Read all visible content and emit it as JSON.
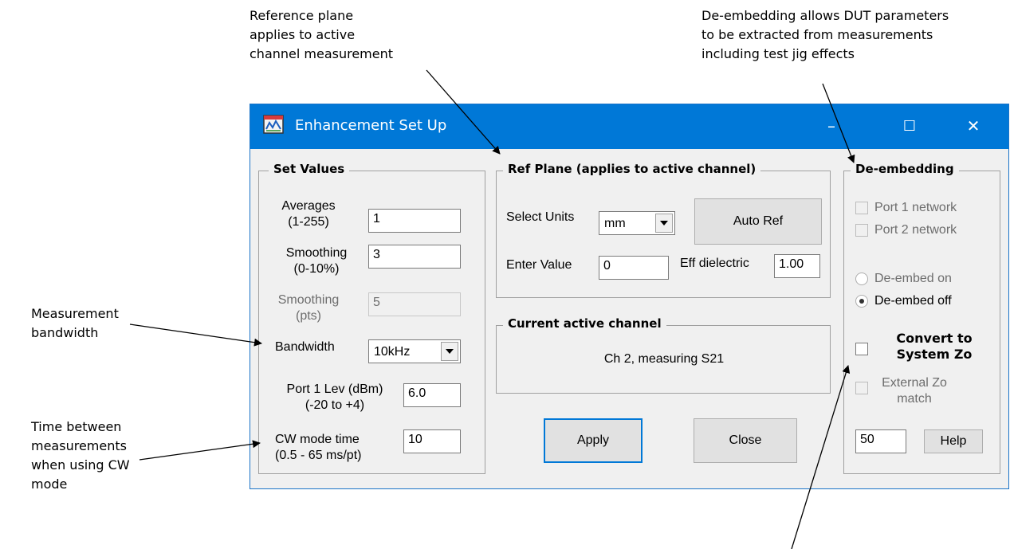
{
  "callouts": {
    "ref_plane": "Reference plane\napplies to active\nchannel measurement",
    "deembed": "De-embedding allows DUT parameters\nto be extracted from measurements\nincluding test jig effects",
    "bandwidth": "Measurement\nbandwidth",
    "cw_time": "Time between\nmeasurements\nwhen using CW\nmode"
  },
  "window": {
    "title": "Enhancement Set Up",
    "minimize_glyph": "–",
    "maximize_glyph": "☐",
    "close_glyph": "✕",
    "title_bar_color": "#0078d7"
  },
  "set_values": {
    "legend": "Set Values",
    "averages_label": "Averages\n(1-255)",
    "averages_value": "1",
    "smoothing_pct_label": "Smoothing\n(0-10%)",
    "smoothing_pct_value": "3",
    "smoothing_pts_label": "Smoothing\n(pts)",
    "smoothing_pts_value": "5",
    "bandwidth_label": "Bandwidth",
    "bandwidth_value": "10kHz",
    "port1_label": "Port 1 Lev (dBm)\n(-20 to +4)",
    "port1_value": "6.0",
    "cw_label": "CW mode time\n(0.5 - 65 ms/pt)",
    "cw_value": "10"
  },
  "ref_plane": {
    "legend": "Ref Plane (applies to active channel)",
    "select_units_label": "Select Units",
    "units_value": "mm",
    "auto_ref_label": "Auto Ref",
    "enter_value_label": "Enter Value",
    "enter_value": "0",
    "eff_dielectric_label": "Eff dielectric",
    "eff_dielectric_value": "1.00"
  },
  "active_channel": {
    "legend": "Current active channel",
    "text": "Ch 2, measuring S21"
  },
  "buttons": {
    "apply": "Apply",
    "close": "Close",
    "help": "Help"
  },
  "deembedding": {
    "legend": "De-embedding",
    "port1_network": "Port 1 network",
    "port2_network": "Port 2 network",
    "deembed_on": "De-embed on",
    "deembed_off": "De-embed off",
    "selected": "De-embed off",
    "convert_label": "Convert to\nSystem Zo",
    "external_label": "External Zo\nmatch",
    "zo_value": "50"
  }
}
